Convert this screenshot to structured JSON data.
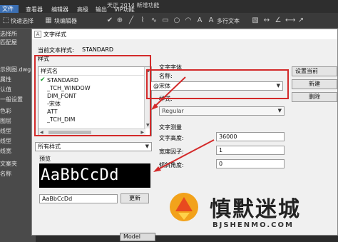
{
  "app": {
    "title": "天正 2014 新增功能",
    "file_menu": "文件",
    "menus": [
      "查看器",
      "编辑器",
      "高级",
      "输出",
      "VIP功能"
    ],
    "toolbar": {
      "quick_select": "快速选择",
      "block_editor": "块编辑器",
      "multiline_text": "多行文本"
    },
    "left_panel": [
      "选择所",
      "匹配屋",
      "示例图.dwg",
      "属性",
      "认值",
      "一般设置",
      "色彩",
      "图层",
      "线型",
      "线型",
      "线宽",
      "文案夹",
      "名称"
    ]
  },
  "dialog": {
    "title": "文字样式",
    "current_style_label": "当前文本样式:",
    "current_style_value": "STANDARD",
    "styles_group_label": "样式",
    "styles_header": "样式名",
    "styles": [
      "STANDARD",
      "_TCH_WINDOW",
      "DIM_FONT",
      "-宋体",
      "ATT",
      "_TCH_DIM"
    ],
    "filter_select": "所有样式",
    "preview_label": "预览",
    "preview_text": "AaBbCcDd",
    "preview_input": "AaBbCcDd",
    "update_button": "更新",
    "font_group_label": "文字字体",
    "font_name_label": "名称:",
    "font_name_value": "@宋体",
    "style_label": "样式:",
    "style_value": "Regular",
    "measure_group_label": "文字测量",
    "height_label": "文字高度:",
    "height_value": "36000",
    "width_label": "宽度因子:",
    "width_value": "1",
    "oblique_label": "倾斜角度:",
    "oblique_value": "0",
    "set_current_button": "设置当前",
    "new_button": "新建",
    "delete_button": "删除"
  },
  "bottom_tab": "Model",
  "watermark": {
    "title": "慎默迷城",
    "subtitle": "BJSHENMO.COM"
  },
  "colors": {
    "highlight_red": "#d32a2a",
    "check_green": "#1a9a2e",
    "file_menu_blue": "#3b6fb3"
  }
}
